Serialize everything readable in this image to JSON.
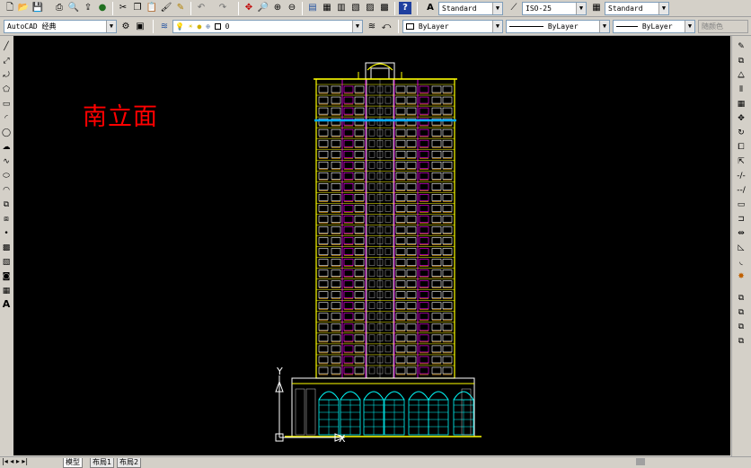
{
  "toolbar1": {
    "text_style": "Standard",
    "dim_style": "ISO-25",
    "table_style": "Standard"
  },
  "toolbar2": {
    "workspace": "AutoCAD 经典",
    "layer": "0",
    "color": "ByLayer",
    "linetype": "ByLayer",
    "lineweight": "ByLayer",
    "plot_style": "随颜色"
  },
  "drawing": {
    "label": "南立面",
    "label_color": "#ff0000",
    "axis_y": "Y",
    "axis_x": "X"
  },
  "layout_tabs": [
    "模型",
    "布局1",
    "布局2"
  ],
  "colors": {
    "canvas_bg": "#000000",
    "building_outline": "#ffff00",
    "window_magenta": "#ff00ff",
    "window_white": "#ffffff",
    "podium_cyan": "#00ffff",
    "band_blue": "#00aaff"
  }
}
